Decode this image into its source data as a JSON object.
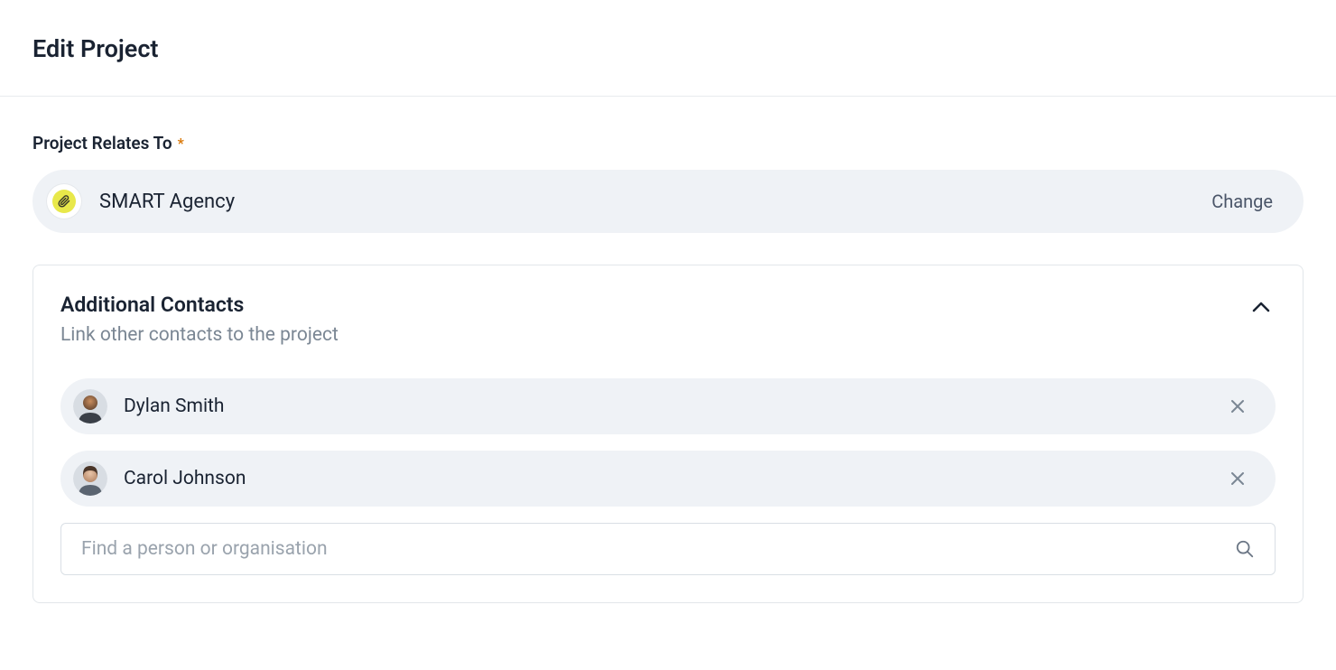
{
  "page": {
    "title": "Edit Project"
  },
  "relatesTo": {
    "label": "Project Relates To",
    "required": "*",
    "org": {
      "name": "SMART Agency",
      "icon": "paperclip"
    },
    "changeLabel": "Change"
  },
  "additionalContacts": {
    "title": "Additional Contacts",
    "subtitle": "Link other contacts to the project",
    "contacts": [
      {
        "name": "Dylan Smith"
      },
      {
        "name": "Carol Johnson"
      }
    ],
    "search": {
      "placeholder": "Find a person or organisation"
    }
  }
}
